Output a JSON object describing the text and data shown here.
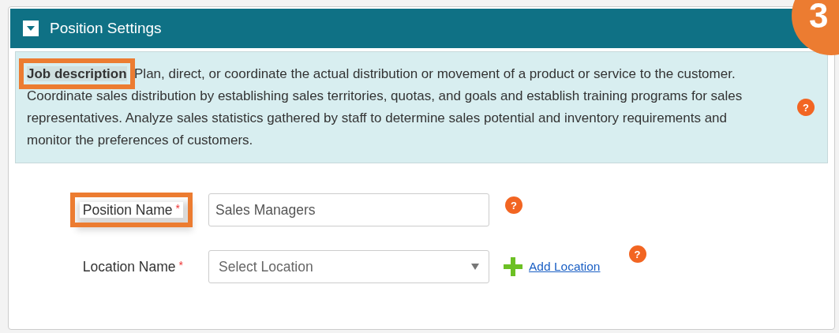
{
  "panel": {
    "title": "Position Settings",
    "expanded": true,
    "step_badge": "3"
  },
  "job_description": {
    "label": "Job description",
    "highlighted": true,
    "help": "?",
    "text": "Plan, direct, or coordinate the actual distribution or movement of a product or service to the customer. Coordinate sales distribution by establishing sales territories, quotas, and goals and establish training programs for sales representatives. Analyze sales statistics gathered by staff to determine sales potential and inventory requirements and monitor the preferences of customers."
  },
  "fields": [
    {
      "kind": "text",
      "label": "Position Name",
      "required_mark": "*",
      "highlighted": true,
      "value": "Sales Managers",
      "help": "?"
    },
    {
      "kind": "select",
      "label": "Location Name",
      "required_mark": "*",
      "highlighted": false,
      "placeholder": "Select Location",
      "link": "Add Location",
      "help": "?"
    }
  ]
}
